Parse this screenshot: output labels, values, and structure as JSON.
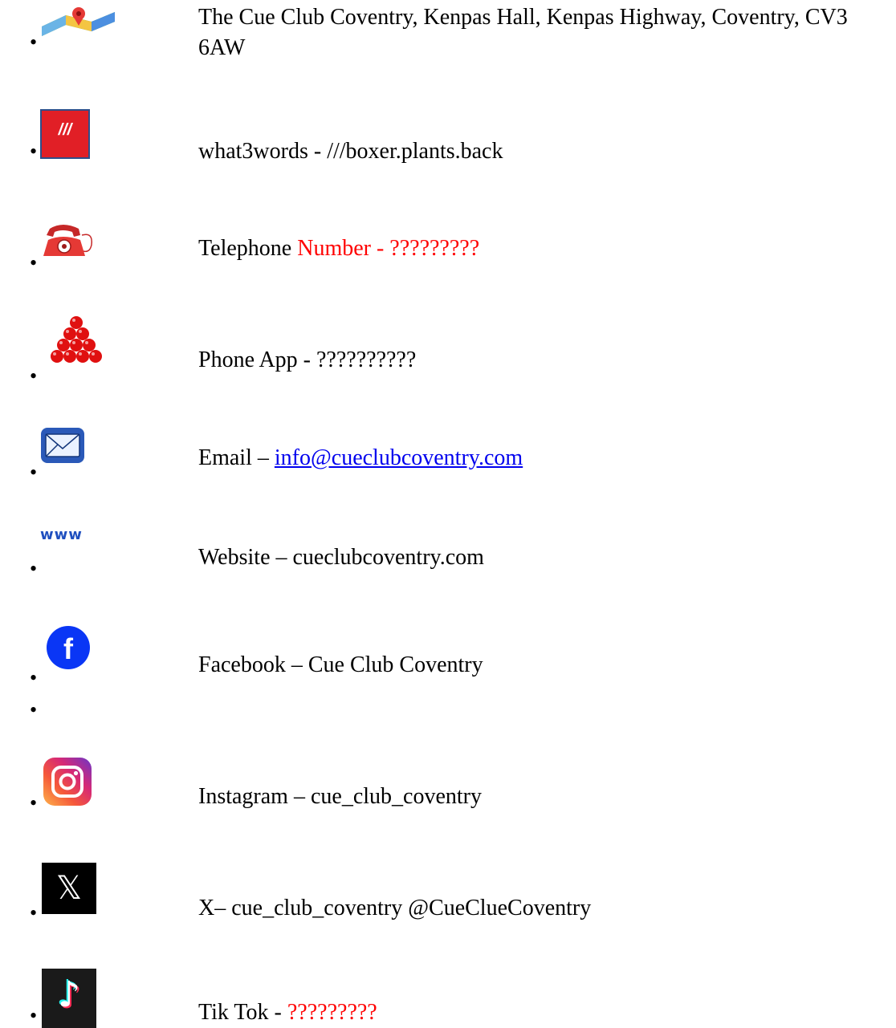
{
  "items": [
    {
      "icon": "map-pin-icon",
      "text": "The Cue Club Coventry, Kenpas Hall, Kenpas Highway, Coventry, CV3 6AW"
    },
    {
      "icon": "what3words-icon",
      "icon_text": "///",
      "text": "what3words - ///boxer.plants.back"
    },
    {
      "icon": "telephone-icon",
      "label": "Telephone ",
      "label_red": "Number -  ",
      "value": "?????????"
    },
    {
      "icon": "snooker-balls-icon",
      "text": "Phone App - ??????????"
    },
    {
      "icon": "envelope-icon",
      "label": "Email – ",
      "link": "info@cueclubcoventry.com"
    },
    {
      "icon": "www-icon",
      "icon_text": "www",
      "text": "Website – cueclubcoventry.com"
    },
    {
      "icon": "facebook-icon",
      "icon_text": "f",
      "text": "Facebook – Cue Club Coventry"
    },
    {
      "icon": "instagram-icon",
      "text": "Instagram – cue_club_coventry"
    },
    {
      "icon": "x-icon",
      "icon_text": "𝕏",
      "text": "X– cue_club_coventry @CueClueCoventry"
    },
    {
      "icon": "tiktok-icon",
      "icon_text": "♪",
      "label": "Tik Tok - ",
      "value": "?????????"
    }
  ],
  "colors": {
    "accent_red": "#ff0000",
    "link_blue": "#0000ee",
    "facebook_blue": "#0a36f5",
    "what3words_red": "#e11f26"
  }
}
